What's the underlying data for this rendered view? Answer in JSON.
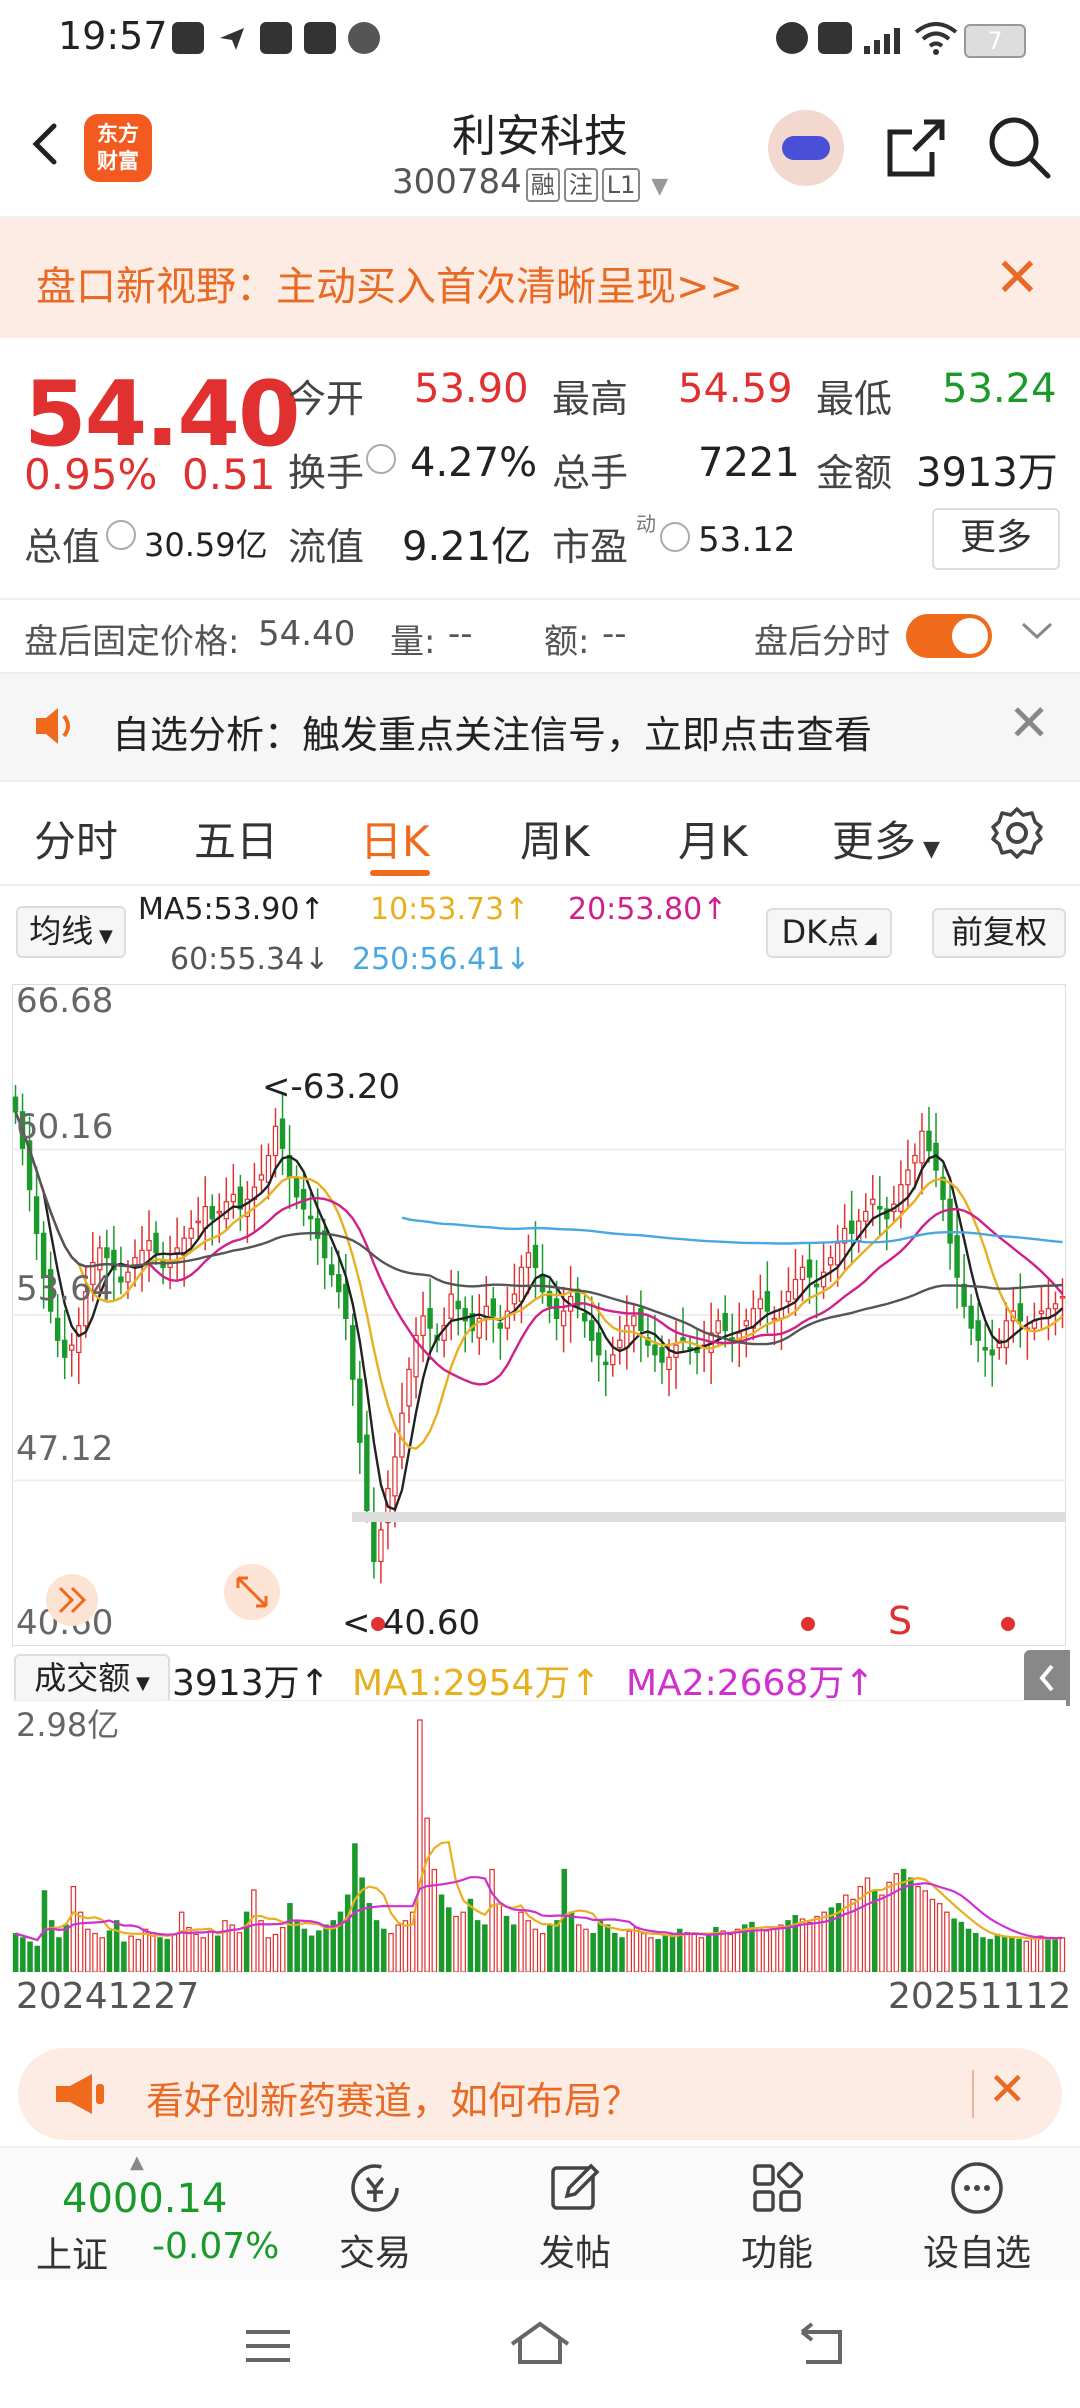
{
  "status_bar": {
    "time": "19:57",
    "battery": "7"
  },
  "header": {
    "logo_text": "东方\n财富",
    "stock_name": "利安科技",
    "stock_code": "300784",
    "tags": [
      "融",
      "注",
      "L1"
    ]
  },
  "promo": {
    "text": "盘口新视野：主动买入首次清晰呈现>>"
  },
  "quote": {
    "price": "54.40",
    "change_pct": "0.95%",
    "change_amt": "0.51",
    "open_label": "今开",
    "open": "53.90",
    "high_label": "最高",
    "high": "54.59",
    "low_label": "最低",
    "low": "53.24",
    "turnover_label": "换手",
    "turnover": "4.27%",
    "volume_label": "总手",
    "volume": "7221",
    "amount_label": "金额",
    "amount": "3913万",
    "mktcap_label": "总值",
    "mktcap": "30.59亿",
    "float_label": "流值",
    "float_cap": "9.21亿",
    "pe_label": "市盈",
    "pe_sup": "动",
    "pe": "53.12",
    "more_button": "更多"
  },
  "after_hours": {
    "fixed_price_label": "盘后固定价格:",
    "fixed_price": "54.40",
    "volume_label": "量:",
    "volume": "--",
    "amount_label": "额:",
    "amount": "--",
    "intraday_label": "盘后分时",
    "toggle_on": true
  },
  "analysis": {
    "text": "自选分析：触发重点关注信号，立即点击查看"
  },
  "tabs": [
    "分时",
    "五日",
    "日K",
    "周K",
    "月K",
    "更多"
  ],
  "active_tab": "日K",
  "ma_row": {
    "selector": "均线",
    "ma5": "MA5:53.90↑",
    "ma10": "10:53.73↑",
    "ma20": "20:53.80↑",
    "ma60": "60:55.34↓",
    "ma250": "250:56.41↓",
    "dk_button": "DK点",
    "adjust_button": "前复权"
  },
  "colors": {
    "up": "#e03030",
    "down": "#1a9a2a",
    "accent": "#f06a1e",
    "ma5": "#222222",
    "ma10": "#e8b020",
    "ma20": "#d0208a",
    "ma60": "#555555",
    "ma250": "#4aa8e0"
  },
  "chart_data": {
    "type": "candlestick",
    "y_ticks": [
      "66.68",
      "60.16",
      "53.64",
      "47.12",
      "40.60"
    ],
    "ylim": [
      40.6,
      66.68
    ],
    "high_annotation": "<-63.20",
    "low_annotation": "<-40.60",
    "signal_label": "S",
    "closes": [
      62.0,
      60.5,
      58.8,
      57.0,
      55.2,
      53.8,
      52.6,
      51.9,
      52.4,
      53.2,
      54.6,
      55.8,
      56.4,
      56.0,
      55.5,
      55.0,
      55.4,
      56.0,
      56.3,
      56.7,
      56.2,
      55.6,
      55.9,
      56.4,
      56.8,
      57.2,
      57.5,
      58.1,
      57.6,
      57.9,
      58.3,
      58.6,
      58.0,
      58.4,
      58.9,
      59.4,
      60.2,
      61.4,
      60.5,
      59.3,
      58.5,
      58.0,
      57.6,
      56.8,
      56.0,
      55.3,
      54.6,
      53.5,
      51.0,
      48.4,
      45.6,
      43.5,
      44.8,
      46.5,
      47.8,
      49.6,
      51.4,
      52.8,
      53.6,
      53.1,
      52.6,
      53.2,
      54.5,
      53.9,
      53.4,
      53.0,
      53.5,
      54.0,
      53.6,
      53.1,
      53.8,
      54.5,
      55.6,
      56.2,
      55.6,
      54.6,
      54.0,
      53.5,
      53.8,
      54.4,
      54.0,
      53.4,
      52.6,
      52.0,
      51.6,
      52.0,
      52.6,
      53.2,
      53.6,
      53.0,
      52.4,
      52.0,
      51.7,
      51.9,
      52.4,
      52.6,
      52.3,
      52.1,
      52.4,
      52.9,
      53.4,
      53.0,
      52.6,
      52.9,
      53.4,
      53.9,
      54.3,
      53.8,
      53.5,
      53.9,
      54.6,
      55.1,
      55.6,
      55.2,
      54.8,
      55.4,
      56.0,
      56.6,
      57.2,
      57.0,
      57.5,
      57.9,
      58.4,
      58.0,
      57.6,
      58.2,
      59.0,
      59.6,
      60.2,
      61.2,
      60.4,
      59.6,
      58.4,
      56.6,
      55.2,
      54.0,
      53.1,
      52.6,
      52.2,
      52.0,
      52.6,
      53.4,
      53.8,
      53.4,
      53.1,
      53.4,
      53.8,
      53.9,
      54.1,
      54.4
    ],
    "volume_ylim_label": "2.98亿",
    "volume_label": "成交额",
    "volume_latest": "3913万↑",
    "volume_ma1": "MA1:2954万↑",
    "volume_ma2": "MA2:2668万↑",
    "volumes": [
      45,
      40,
      35,
      30,
      95,
      60,
      40,
      55,
      100,
      70,
      50,
      45,
      40,
      48,
      60,
      35,
      42,
      38,
      50,
      46,
      40,
      38,
      44,
      70,
      52,
      44,
      40,
      48,
      42,
      60,
      55,
      46,
      70,
      96,
      60,
      40,
      44,
      52,
      80,
      60,
      50,
      42,
      48,
      55,
      60,
      70,
      90,
      150,
      110,
      80,
      60,
      50,
      45,
      55,
      60,
      70,
      295,
      180,
      120,
      90,
      75,
      65,
      70,
      85,
      60,
      55,
      120,
      80,
      65,
      55,
      70,
      60,
      50,
      45,
      55,
      60,
      120,
      70,
      55,
      50,
      45,
      60,
      55,
      45,
      40,
      48,
      52,
      45,
      40,
      38,
      42,
      45,
      50,
      46,
      44,
      40,
      45,
      52,
      48,
      44,
      50,
      55,
      58,
      52,
      48,
      50,
      55,
      60,
      66,
      62,
      58,
      65,
      70,
      75,
      80,
      90,
      85,
      100,
      110,
      95,
      90,
      105,
      115,
      120,
      110,
      100,
      95,
      85,
      80,
      70,
      62,
      58,
      50,
      45,
      40,
      38,
      44,
      42,
      40,
      38,
      36,
      40,
      42,
      39,
      38,
      40
    ],
    "x_start": "20241227",
    "x_end": "20251112"
  },
  "bottom_promo": {
    "text": "看好创新药赛道，如何布局？"
  },
  "bottom_nav": {
    "index_value": "4000.14",
    "index_name": "上证",
    "index_change": "-0.07%",
    "items": [
      "交易",
      "发帖",
      "功能",
      "设自选"
    ]
  }
}
